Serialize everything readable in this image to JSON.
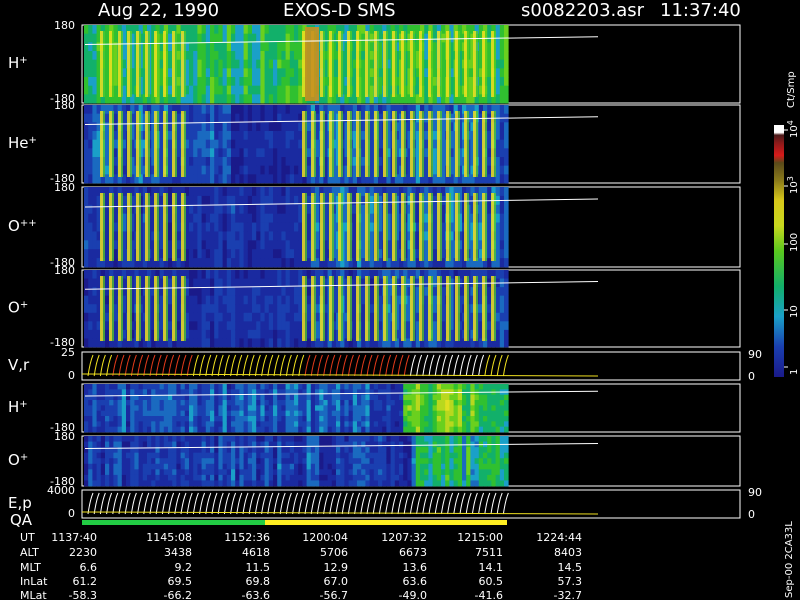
{
  "header": {
    "date": "Aug 22, 1990",
    "instrument": "EXOS-D SMS",
    "file": "s0082203.asr",
    "time": "11:37:40"
  },
  "colorbar": {
    "unit": "Ct/Smp",
    "ticks": [
      "1",
      "10",
      "100",
      "10",
      "10"
    ],
    "tick_exponents": [
      "",
      "",
      "",
      "3",
      "4"
    ]
  },
  "side_label": "Sep-00  2CA33L",
  "footer": {
    "row_labels": [
      "UT",
      "ALT",
      "MLT",
      "InLat",
      "MLat"
    ],
    "columns": [
      [
        "1137:40",
        "2230",
        "6.6",
        "61.2",
        "-58.3"
      ],
      [
        "1145:08",
        "3438",
        "9.2",
        "69.5",
        "-66.2"
      ],
      [
        "1152:36",
        "4618",
        "11.5",
        "69.8",
        "-63.6"
      ],
      [
        "1200:04",
        "5706",
        "12.9",
        "67.0",
        "-56.7"
      ],
      [
        "1207:32",
        "6673",
        "13.6",
        "63.6",
        "-49.0"
      ],
      [
        "1215:00",
        "7511",
        "14.1",
        "60.5",
        "-41.6"
      ],
      [
        "1224:44",
        "8403",
        "14.5",
        "57.3",
        "-32.7"
      ]
    ]
  },
  "chart_data": {
    "type": "heatmap",
    "x_axis": "UT",
    "x_ticks": [
      "1137:40",
      "1145:08",
      "1152:36",
      "1200:04",
      "1207:32",
      "1215:00",
      "1224:44"
    ],
    "color_scale": "log",
    "color_range": [
      1,
      10000
    ],
    "qa_bar_colors": [
      "#22cc44",
      "#ffee22"
    ],
    "panels": [
      {
        "label": "H",
        "sup": "+",
        "ymax": "180",
        "ymin": "-180",
        "yticks_right": [],
        "profile": "H"
      },
      {
        "label": "He",
        "sup": "+",
        "ymax": "180",
        "ymin": "-180",
        "yticks_right": [],
        "profile": "He"
      },
      {
        "label": "O",
        "sup": "++",
        "ymax": "180",
        "ymin": "-180",
        "yticks_right": [],
        "profile": "O2"
      },
      {
        "label": "O",
        "sup": "+",
        "ymax": "180",
        "ymin": "-180",
        "yticks_right": [],
        "profile": "O"
      },
      {
        "label": "V,r",
        "sup": "",
        "ymax": "25",
        "ymin": "0",
        "yticks_right": [
          "90",
          "0"
        ],
        "profile": "V"
      },
      {
        "label": "H",
        "sup": "+",
        "ymax": "",
        "ymin": "-180",
        "yticks_right": [],
        "profile": "H2"
      },
      {
        "label": "O",
        "sup": "+",
        "ymax": "180",
        "ymin": "-180",
        "yticks_right": [],
        "profile": "O3"
      },
      {
        "label": "E,p",
        "sup": "",
        "ymax": "4000",
        "ymin": "0",
        "yticks_right": [
          "90",
          "0"
        ],
        "profile": "E"
      }
    ],
    "qa_label": "QA"
  }
}
